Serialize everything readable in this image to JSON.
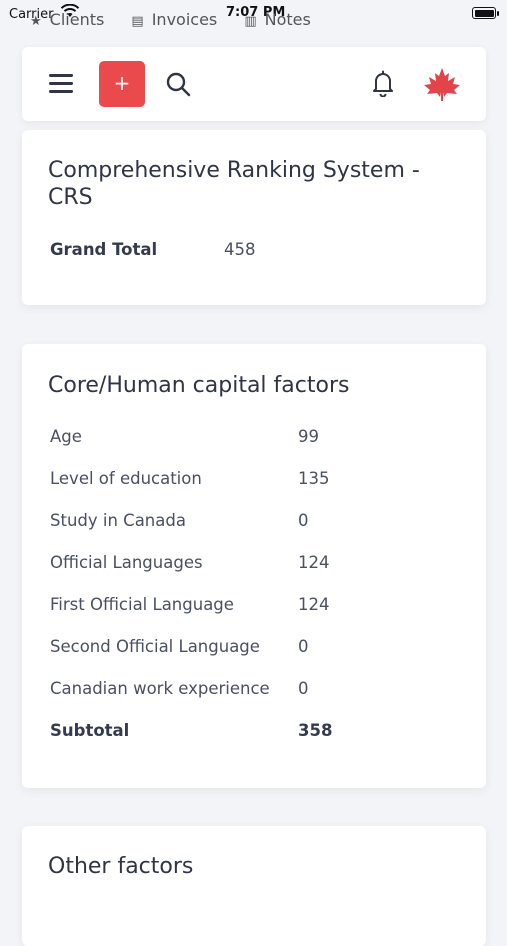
{
  "status_bar": {
    "carrier": "Carrier",
    "time": "7:07 PM"
  },
  "background_tabs": [
    "Clients",
    "Invoices",
    "Notes"
  ],
  "topbar": {
    "add_label": "+",
    "accent_color": "#ea4a4c",
    "icons": [
      "hamburger-menu-icon",
      "search-icon",
      "bell-icon",
      "maple-leaf-avatar"
    ]
  },
  "crs_card": {
    "title": "Comprehensive Ranking System - CRS",
    "grand_total_label": "Grand Total",
    "grand_total_value": "458"
  },
  "core_card": {
    "title": "Core/Human capital factors",
    "rows": [
      {
        "label": "Age",
        "value": "99"
      },
      {
        "label": "Level of education",
        "value": "135"
      },
      {
        "label": "Study in Canada",
        "value": "0"
      },
      {
        "label": "Official Languages",
        "value": "124"
      },
      {
        "label": "First Official Language",
        "value": "124"
      },
      {
        "label": "Second Official Language",
        "value": "0"
      },
      {
        "label": "Canadian work experience",
        "value": "0"
      }
    ],
    "subtotal_label": "Subtotal",
    "subtotal_value": "358"
  },
  "other_card": {
    "title": "Other factors"
  }
}
